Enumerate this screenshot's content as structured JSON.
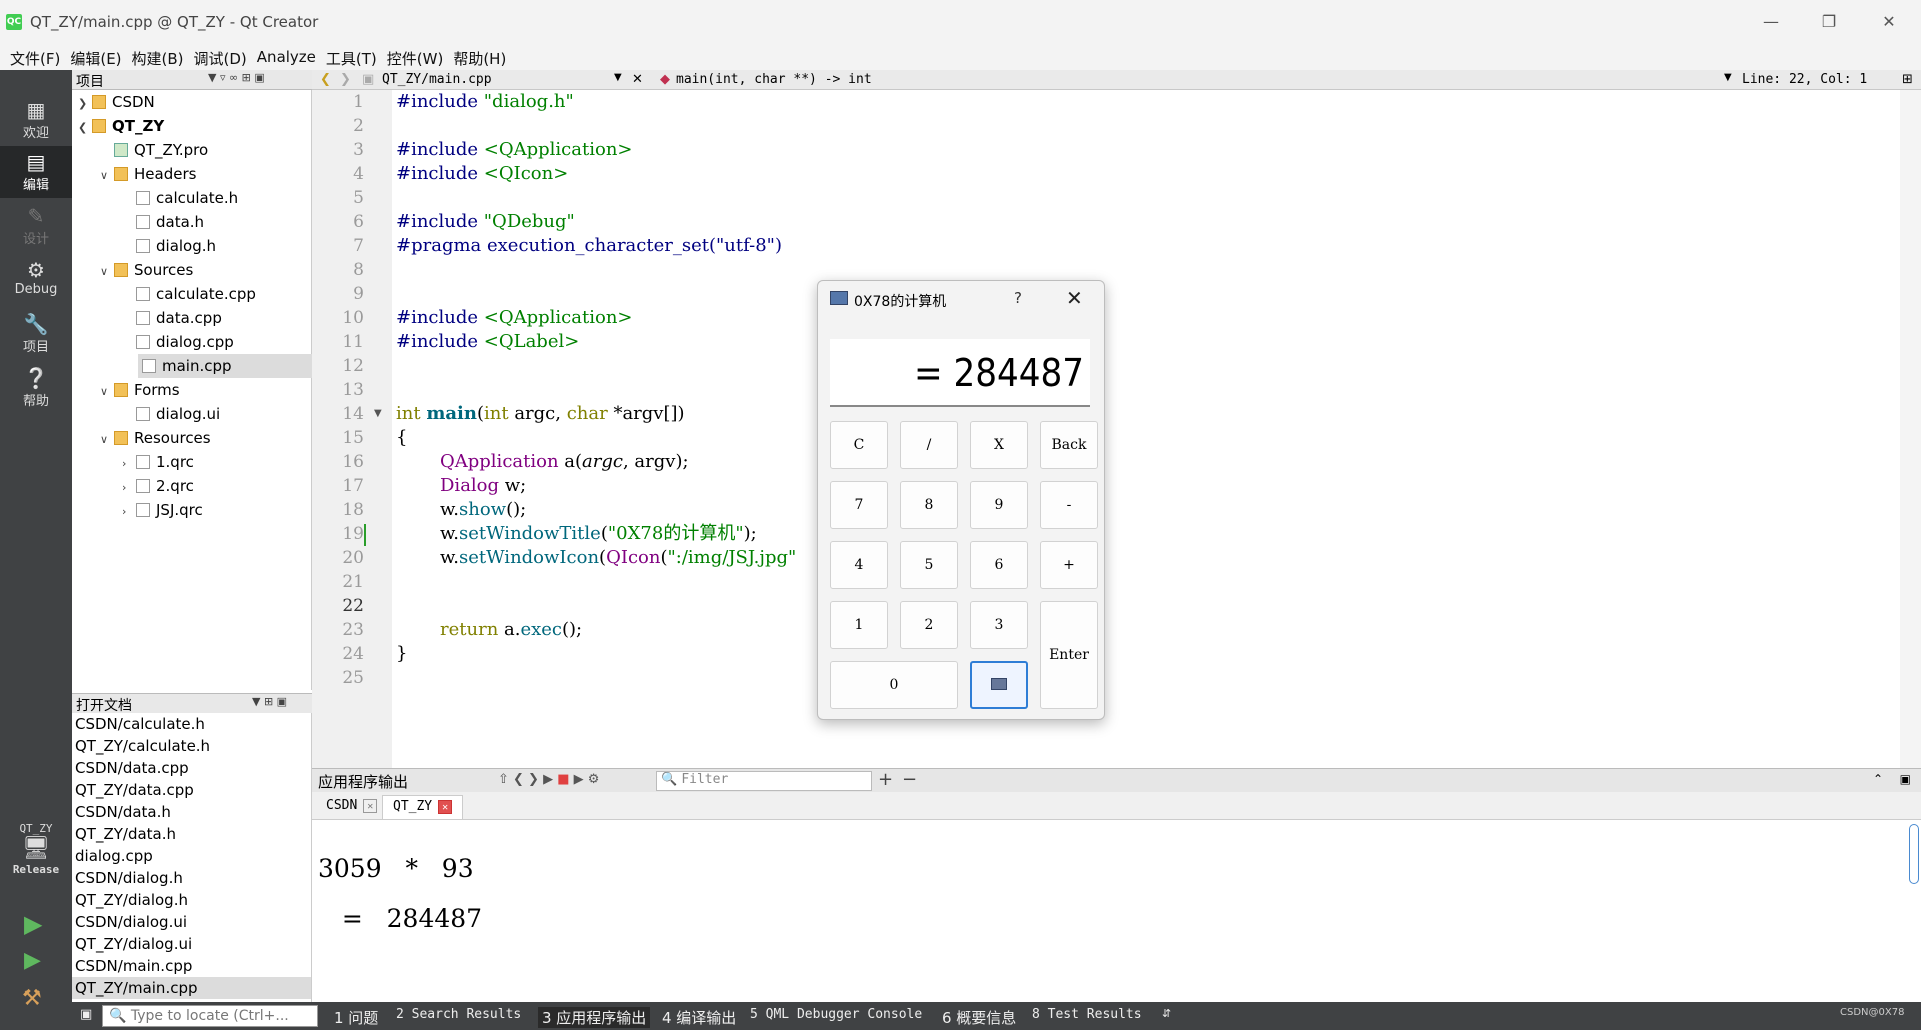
{
  "window": {
    "title": "QT_ZY/main.cpp @ QT_ZY - Qt Creator",
    "logo": "QC"
  },
  "menu": [
    "文件(F)",
    "编辑(E)",
    "构建(B)",
    "调试(D)",
    "Analyze",
    "工具(T)",
    "控件(W)",
    "帮助(H)"
  ],
  "modes": [
    {
      "label": "欢迎",
      "icon": "grid-icon"
    },
    {
      "label": "编辑",
      "icon": "edit-icon"
    },
    {
      "label": "设计",
      "icon": "pencil-icon"
    },
    {
      "label": "Debug",
      "icon": "bug-icon"
    },
    {
      "label": "项目",
      "icon": "wrench-icon"
    },
    {
      "label": "帮助",
      "icon": "help-icon"
    }
  ],
  "kit": {
    "project": "QT_ZY",
    "config": "Release"
  },
  "project_panel": {
    "title": "项目",
    "nodes": [
      "CSDN",
      "QT_ZY",
      "QT_ZY.pro",
      "Headers",
      "calculate.h",
      "data.h",
      "dialog.h",
      "Sources",
      "calculate.cpp",
      "data.cpp",
      "dialog.cpp",
      "main.cpp",
      "Forms",
      "dialog.ui",
      "Resources",
      "1.qrc",
      "2.qrc",
      "JSJ.qrc"
    ]
  },
  "open_docs": {
    "title": "打开文档",
    "items": [
      "CSDN/calculate.h",
      "QT_ZY/calculate.h",
      "CSDN/data.cpp",
      "QT_ZY/data.cpp",
      "CSDN/data.h",
      "QT_ZY/data.h",
      "dialog.cpp",
      "CSDN/dialog.h",
      "QT_ZY/dialog.h",
      "CSDN/dialog.ui",
      "QT_ZY/dialog.ui",
      "CSDN/main.cpp",
      "QT_ZY/main.cpp"
    ]
  },
  "editor": {
    "file": "QT_ZY/main.cpp",
    "symbol": "main(int, char **) -> int",
    "position": "Line: 22, Col: 1",
    "line_numbers": [
      "1",
      "2",
      "3",
      "4",
      "5",
      "6",
      "7",
      "8",
      "9",
      "10",
      "11",
      "12",
      "13",
      "14",
      "15",
      "16",
      "17",
      "18",
      "19",
      "20",
      "21",
      "22",
      "23",
      "24",
      "25"
    ],
    "code": {
      "l1_kw": "#include",
      "l1_str": "\"dialog.h\"",
      "l3_kw": "#include",
      "l3_str": "<QApplication>",
      "l4_kw": "#include",
      "l4_str": "<QIcon>",
      "l6_kw": "#include",
      "l6_str": "\"QDebug\"",
      "l7_kw": "#pragma",
      "l7_rest": "execution_character_set(\"utf-8\")",
      "l10_kw": "#include",
      "l10_str": "<QApplication>",
      "l11_kw": "#include",
      "l11_str": "<QLabel>",
      "l14_t1": "int",
      "l14_fn": "main",
      "l14_p1": "(",
      "l14_t2": "int",
      "l14_a": " argc, ",
      "l14_t3": "char",
      "l14_b": " *argv[])",
      "l15": "{",
      "l16_ty": "QApplication",
      "l16_rest": " a(",
      "l16_it": "argc",
      "l16_end": ", argv);",
      "l17_ty": "Dialog",
      "l17_rest": " w;",
      "l18_a": "w.",
      "l18_fn": "show",
      "l18_end": "();",
      "l19_a": "w.",
      "l19_fn": "setWindowTitle",
      "l19_p": "(",
      "l19_str": "\"0X78的计算机\"",
      "l19_end": ");",
      "l20_a": "w.",
      "l20_fn": "setWindowIcon",
      "l20_p": "(",
      "l20_ty": "QIcon",
      "l20_p2": "(",
      "l20_str": "\":/img/JSJ.jpg\"",
      "l23_kw": "return",
      "l23_a": " a.",
      "l23_fn": "exec",
      "l23_end": "();",
      "l24": "}"
    }
  },
  "output_pane": {
    "title": "应用程序输出",
    "filter_placeholder": "Filter",
    "tabs": [
      "CSDN",
      "QT_ZY"
    ],
    "line1": "3059   *   93",
    "line2": "   =   284487"
  },
  "status_tabs": [
    "1 问题",
    "2 Search Results",
    "3 应用程序输出",
    "4 编译输出",
    "5 QML Debugger Console",
    "6 概要信息",
    "8 Test Results"
  ],
  "locator_placeholder": "Type to locate (Ctrl+...",
  "calculator": {
    "title": "0X78的计算机",
    "help": "?",
    "display": "= 284487",
    "buttons": {
      "c": "C",
      "div": "/",
      "mul": "X",
      "back": "Back",
      "n7": "7",
      "n8": "8",
      "n9": "9",
      "minus": "-",
      "n4": "4",
      "n5": "5",
      "n6": "6",
      "plus": "+",
      "n1": "1",
      "n2": "2",
      "n3": "3",
      "enter": "Enter",
      "n0": "0"
    }
  },
  "tray_text": "CSDN@0X78"
}
